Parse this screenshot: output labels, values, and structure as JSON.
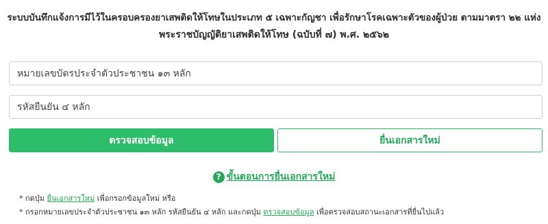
{
  "header": {
    "title_line1": "ระบบบันทึกแจ้งการมีไว้ในครอบครองยาเสพติดให้โทษในประเภท ๕ เฉพาะกัญชา เพื่อรักษาโรคเฉพาะตัวของผู้ป่วย ตามมาตรา ๒๒ แห่ง",
    "title_line2": "พระราชบัญญัติยาเสพติดให้โทษ (ฉบับที่ ๗) พ.ศ. ๒๕๖๒"
  },
  "form": {
    "id_placeholder": "หมายเลขบัตรประจำตัวประชาชน ๑๓ หลัก",
    "code_placeholder": "รหัสยืนยัน ๔ หลัก",
    "check_label": "ตรวจสอบข้อมูล",
    "new_label": "ยื่นเอกสารใหม่"
  },
  "help": {
    "icon": "question-circle-icon",
    "steps_label": "ขั้นตอนการยื่นเอกสารใหม่"
  },
  "notes": {
    "note1_prefix": "* กดปุ่ม ",
    "note1_link": "ยื่นเอกสารใหม่",
    "note1_suffix": " เพื่อกรอกข้อมูลใหม่ หรือ",
    "note2_prefix": "* กรอกหมายเลขประจำตัวประชาชน ๑๓ หลัก รหัสยืนยัน ๔ หลัก และกดปุ่ม ",
    "note2_link": "ตรวจสอบข้อมูล",
    "note2_suffix": " เพื่อตรวจสอบสถานะเอกสารที่ยื่นไปแล้ว"
  },
  "colors": {
    "accent": "#2ebd6b",
    "accent_text": "#27a95b"
  }
}
